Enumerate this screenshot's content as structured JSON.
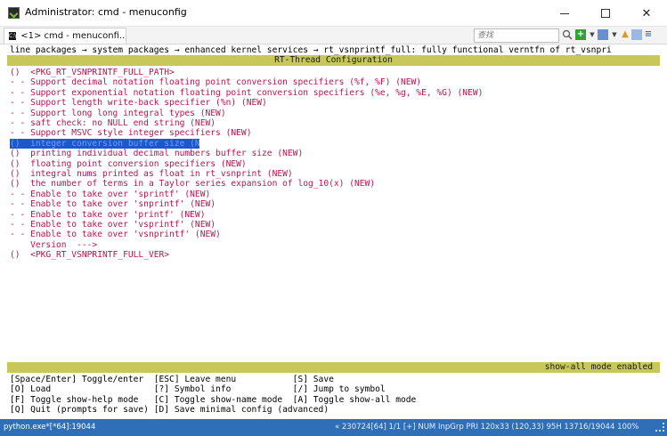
{
  "window": {
    "title": "Administrator: cmd - menuconfig"
  },
  "tabbar": {
    "tab_label": "<1> cmd - menuconfi...",
    "search_placeholder": "查找"
  },
  "terminal": {
    "breadcrumb": "line packages → system packages → enhanced kernel services → rt_vsnprintf_full: fully functional verntfn of rt_vsnpri",
    "config_title": "RT-Thread Configuration",
    "options": [
      "()  <PKG_RT_VSNPRINTF_FULL_PATH>",
      "- - Support decimal notation floating point conversion specifiers (%f, %F) (NEW)",
      "- - Support exponential notation floating point conversion specifiers (%e, %g, %E, %G) (NEW)",
      "- - Support length write-back specifier (%n) (NEW)",
      "- - Support long long integral types (NEW)",
      "- - saft check: no NULL end string (NEW)",
      "- - Support MSVC style integer specifiers (NEW)",
      "()  integer conversion buffer size (NEW)",
      "()  printing individual decimal numbers buffer size (NEW)",
      "()  floating point conversion specifiers (NEW)",
      "()  integral nums printed as float in rt_vsnprint (NEW)",
      "()  the number of terms in a Taylor series expansion of log_10(x) (NEW)",
      "- - Enable to take over 'sprintf' (NEW)",
      "- - Enable to take over 'snprintf' (NEW)",
      "- - Enable to take over 'printf' (NEW)",
      "- - Enable to take over 'vsprintf' (NEW)",
      "- - Enable to take over 'vsnprintf' (NEW)",
      "    Version  --->",
      "()  <PKG_RT_VSNPRINTF_FULL_VER>"
    ],
    "selected_index": 7,
    "mode_status": "show-all mode enabled",
    "help_lines": [
      "[Space/Enter] Toggle/enter  [ESC] Leave menu           [S] Save",
      "[O] Load                    [?] Symbol info            [/] Jump to symbol",
      "[F] Toggle show-help mode   [C] Toggle show-name mode  [A] Toggle show-all mode",
      "[Q] Quit (prompts for save) [D] Save minimal config (advanced)"
    ]
  },
  "console_status": {
    "left": "python.exe*[*64]:19044",
    "right": "« 230724[64]  1/1  [+] NUM  InpGrp  PRI   120x33  (120,33) 95H  13716/19044 100%"
  },
  "colors": {
    "accent_bar": "#c8c85a",
    "option_text": "#b8154f",
    "selection": "#1a5ac8",
    "status_bar": "#2f6fb8"
  }
}
